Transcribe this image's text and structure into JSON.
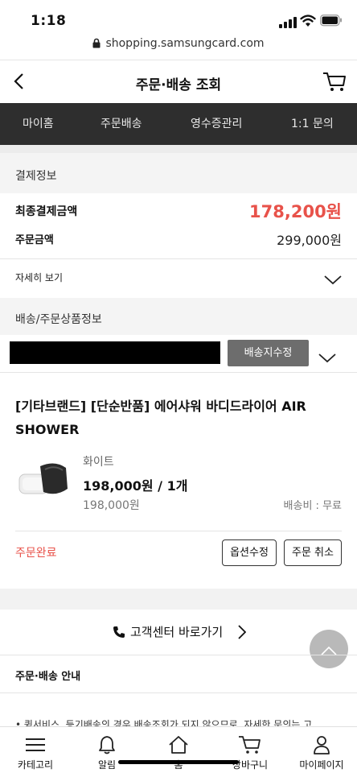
{
  "status_bar": {
    "time": "1:18"
  },
  "browser": {
    "url": "shopping.samsungcard.com"
  },
  "header": {
    "title": "주문·배송 조회"
  },
  "nav": {
    "items": [
      "마이홈",
      "주문배송",
      "영수증관리",
      "1:1 문의"
    ]
  },
  "payment": {
    "section_title": "결제정보",
    "final_label": "최종결제금액",
    "final_amount": "178,200원",
    "order_label": "주문금액",
    "order_amount": "299,000원",
    "details_label": "자세히 보기"
  },
  "delivery": {
    "section_title": "배송/주문상품정보",
    "edit_address_button": "배송지수정"
  },
  "product": {
    "name": "[기타브랜드] [단순반품] 에어샤워 바디드라이어 AIR SHOWER",
    "option": "화이트",
    "price_qty": "198,000원 / 1개",
    "original_price": "198,000원",
    "shipping": "배송비 : 무료",
    "status": "주문완료",
    "option_edit_button": "옵션수정",
    "cancel_button": "주문 취소"
  },
  "support": {
    "link_label": "고객센터 바로가기"
  },
  "guide": {
    "title": "주문·배송 안내",
    "notice": "• 퀵서비스, 등기배송의 경우 배송조회가 되지 않으므로, 자세한 문의는 고"
  },
  "bottom_nav": {
    "items": [
      "카테고리",
      "알림",
      "홈",
      "장바구니",
      "마이페이지"
    ]
  },
  "colors": {
    "accent_red": "#e8524a",
    "nav_dark": "#2e2e2e",
    "button_gray": "#6d6d6d"
  }
}
